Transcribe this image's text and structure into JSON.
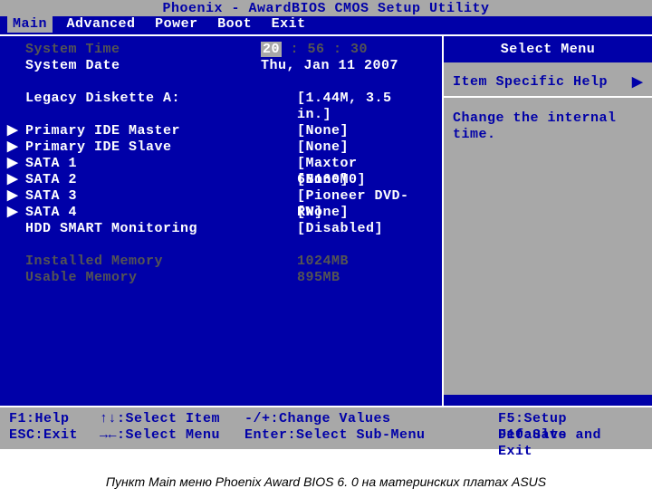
{
  "title": "Phoenix - AwardBIOS CMOS Setup Utility",
  "menu": {
    "items": [
      "Main",
      "Advanced",
      "Power",
      "Boot",
      "Exit"
    ],
    "active": "Main"
  },
  "left": {
    "rows": [
      {
        "arrow": false,
        "dim": true,
        "label": "System Time",
        "value_pre": "20",
        "value_post": " : 56 : 30",
        "selected": true
      },
      {
        "arrow": false,
        "dim": false,
        "label": "System Date",
        "value": "Thu, Jan 11 2007"
      },
      {
        "spacer": true
      },
      {
        "arrow": false,
        "dim": false,
        "label": "Legacy Diskette A:",
        "value": "[1.44M, 3.5 in.]",
        "valClass": "center-val"
      },
      {
        "spacer": true
      },
      {
        "arrow": true,
        "dim": false,
        "label": "Primary IDE Master",
        "value": "[None]",
        "valClass": "center-val"
      },
      {
        "arrow": true,
        "dim": false,
        "label": "Primary IDE Slave",
        "value": "[None]",
        "valClass": "center-val"
      },
      {
        "arrow": true,
        "dim": false,
        "label": "SATA 1",
        "value": "[Maxtor 6B160M0]",
        "valClass": "center-val"
      },
      {
        "arrow": true,
        "dim": false,
        "label": "SATA 2",
        "value": "[None]",
        "valClass": "center-val"
      },
      {
        "arrow": true,
        "dim": false,
        "label": "SATA 3",
        "value": "[Pioneer DVD-RW]",
        "valClass": "center-val"
      },
      {
        "arrow": true,
        "dim": false,
        "label": "SATA 4",
        "value": "[None]",
        "valClass": "center-val"
      },
      {
        "arrow": false,
        "dim": false,
        "label": "HDD SMART Monitoring",
        "value": "[Disabled]",
        "valClass": "center-val"
      },
      {
        "spacer": true
      },
      {
        "arrow": false,
        "dim": true,
        "label": "Installed Memory",
        "value": "1024MB",
        "valClass": "center-val",
        "valIndent": " "
      },
      {
        "arrow": false,
        "dim": true,
        "label": "Usable Memory",
        "value": " 895MB",
        "valClass": "center-val",
        "valIndent": " "
      }
    ]
  },
  "right": {
    "selectMenu": "Select Menu",
    "helpTitle": "Item Specific Help",
    "helpText": "Change the internal time."
  },
  "footer": {
    "r1c1": "F1:Help",
    "r1c2": "↑↓:Select Item",
    "r1c3": "-/+:Change Values",
    "r1c4": "F5:Setup Defaults",
    "r2c1": "ESC:Exit",
    "r2c2": "→←:Select Menu",
    "r2c3": "Enter:Select Sub-Menu",
    "r2c4": "F10:Save and Exit"
  },
  "caption": "Пункт Main меню Phoenix Award BIOS 6. 0 на материнских платах ASUS"
}
